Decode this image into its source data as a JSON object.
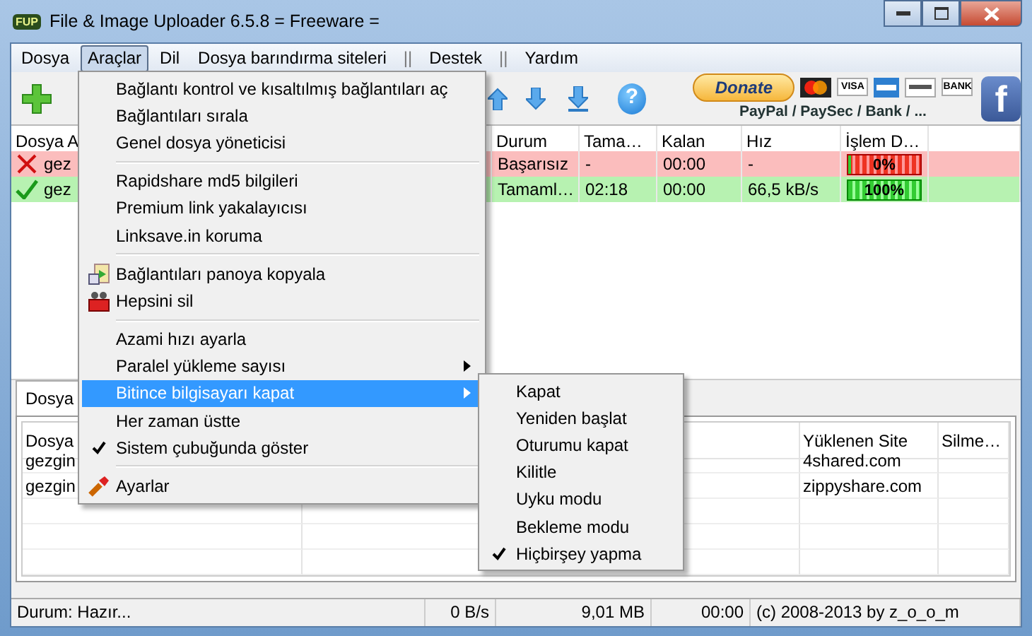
{
  "window": {
    "logo": "FUP",
    "title": "File & Image Uploader 6.5.8  = Freeware ="
  },
  "menubar": [
    {
      "kind": "menu",
      "label": "Dosya",
      "selected": false
    },
    {
      "kind": "menu",
      "label": "Araçlar",
      "selected": true
    },
    {
      "kind": "menu",
      "label": "Dil",
      "selected": false
    },
    {
      "kind": "menu",
      "label": "Dosya barındırma siteleri",
      "selected": false
    },
    {
      "kind": "divider",
      "label": "||"
    },
    {
      "kind": "menu",
      "label": "Destek",
      "selected": false
    },
    {
      "kind": "divider",
      "label": "||"
    },
    {
      "kind": "menu",
      "label": "Yardım",
      "selected": false
    }
  ],
  "toolbar": {
    "help": "?",
    "donate": {
      "label": "Donate",
      "cards": [
        "VISA",
        "BANK"
      ],
      "caption": "PayPal / PaySec / Bank / ..."
    },
    "social": "f"
  },
  "upload_table": {
    "columns": [
      "Dosya A",
      "Durum",
      "Tama…",
      "Kalan",
      "Hız",
      "İşlem D…"
    ],
    "rows": [
      {
        "kind": "failed",
        "file": "gez",
        "state": "Başarısız",
        "done": "-",
        "left": "00:00",
        "speed": "-",
        "progress": {
          "level": 0,
          "label": "0%"
        }
      },
      {
        "kind": "done",
        "file": "gez",
        "state": "Tamaml…",
        "done": "02:18",
        "left": "00:00",
        "speed": "66,5 kB/s",
        "progress": {
          "level": 1,
          "label": "100%"
        }
      }
    ]
  },
  "tabs": [
    {
      "label": "Dosya",
      "selected": true
    }
  ],
  "result_table": {
    "columns": [
      "Dosya",
      "Yüklenen Site",
      "Silme…"
    ],
    "rows": [
      {
        "file": "gezgin",
        "site": "4shared.com"
      },
      {
        "file": "gezgin",
        "site": "zippyshare.com"
      }
    ]
  },
  "status_bar": [
    "Durum: Hazır...",
    "0 B/s",
    "9,01 MB",
    "00:00",
    "(c) 2008-2013 by z_o_o_m"
  ],
  "menu": {
    "items": [
      {
        "kind": "plain",
        "label": "Bağlantı kontrol ve kısaltılmış bağlantıları aç",
        "checked": false,
        "submenu": false,
        "selected": false
      },
      {
        "kind": "plain",
        "label": "Bağlantıları sırala",
        "checked": false,
        "submenu": false,
        "selected": false
      },
      {
        "kind": "plain",
        "label": "Genel dosya yöneticisi",
        "checked": false,
        "submenu": false,
        "selected": false
      },
      {
        "kind": "separator"
      },
      {
        "kind": "plain",
        "label": "Rapidshare md5 bilgileri",
        "checked": false,
        "submenu": false,
        "selected": false
      },
      {
        "kind": "plain",
        "label": "Premium link yakalayıcısı",
        "checked": false,
        "submenu": false,
        "selected": false
      },
      {
        "kind": "plain",
        "label": "Linksave.in koruma",
        "checked": false,
        "submenu": false,
        "selected": false
      },
      {
        "kind": "separator"
      },
      {
        "kind": "clipboard",
        "label": "Bağlantıları panoya kopyala",
        "checked": false,
        "submenu": false,
        "selected": false
      },
      {
        "kind": "basket",
        "label": "Hepsini sil",
        "checked": false,
        "submenu": false,
        "selected": false
      },
      {
        "kind": "separator"
      },
      {
        "kind": "plain",
        "label": "Azami hızı ayarla",
        "checked": false,
        "submenu": false,
        "selected": false
      },
      {
        "kind": "plain",
        "label": "Paralel yükleme sayısı",
        "checked": false,
        "submenu": true,
        "selected": false
      },
      {
        "kind": "plain",
        "label": "Bitince bilgisayarı kapat",
        "checked": false,
        "submenu": true,
        "selected": true
      },
      {
        "kind": "plain",
        "label": "Her zaman üstte",
        "checked": false,
        "submenu": false,
        "selected": false
      },
      {
        "kind": "plain",
        "label": "Sistem çubuğunda göster",
        "checked": true,
        "submenu": false,
        "selected": false
      },
      {
        "kind": "separator"
      },
      {
        "kind": "wrench",
        "label": "Ayarlar",
        "checked": false,
        "submenu": false,
        "selected": false
      }
    ]
  },
  "submenu": {
    "items": [
      {
        "label": "Kapat",
        "checked": false
      },
      {
        "label": "Yeniden başlat",
        "checked": false
      },
      {
        "label": "Oturumu kapat",
        "checked": false
      },
      {
        "label": "Kilitle",
        "checked": false
      },
      {
        "label": "Uyku modu",
        "checked": false
      },
      {
        "label": "Bekleme modu",
        "checked": false
      },
      {
        "label": "Hiçbirşey yapma",
        "checked": true
      }
    ]
  }
}
